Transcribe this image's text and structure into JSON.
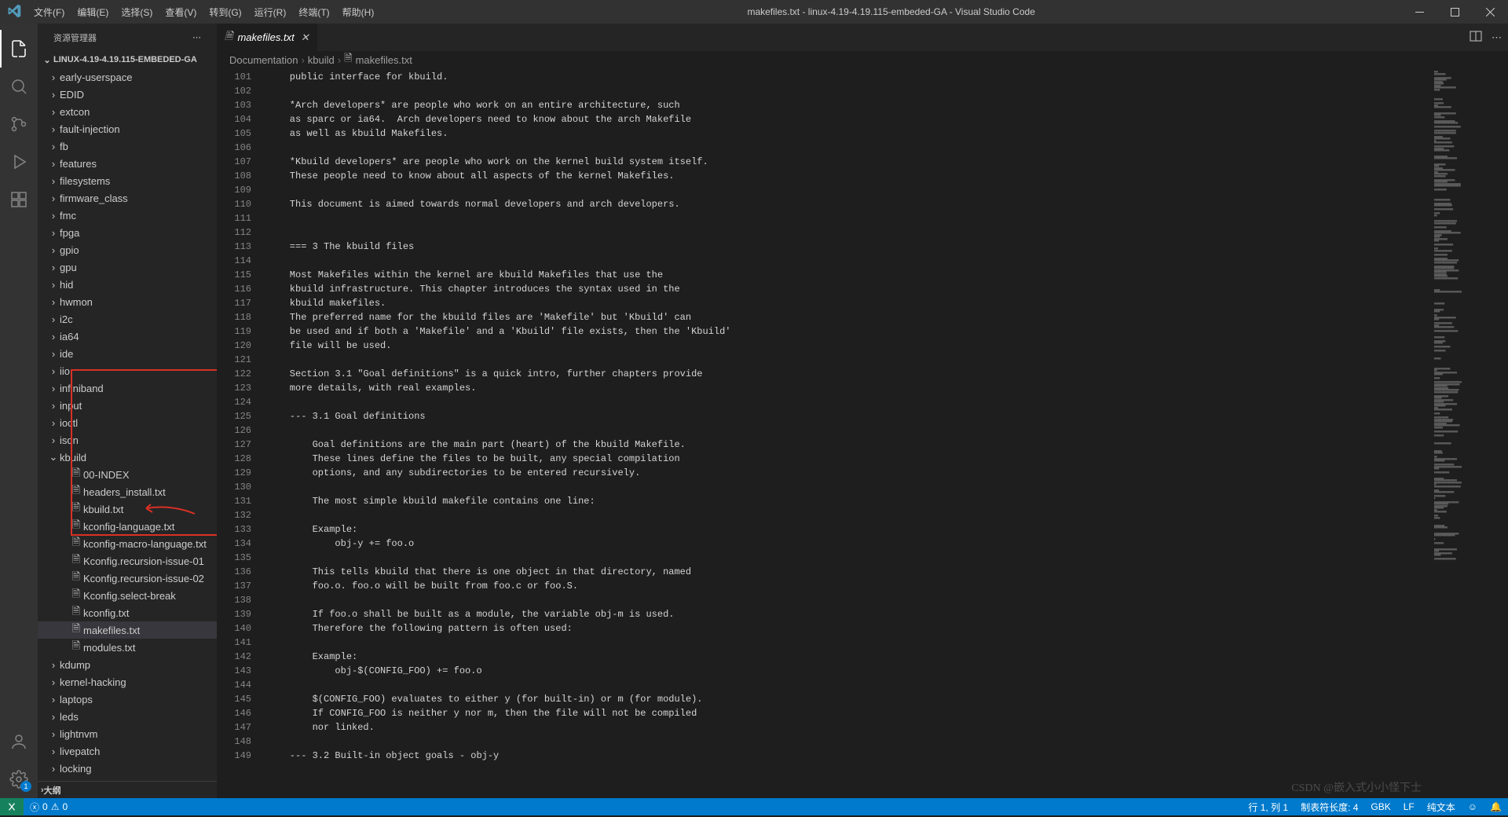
{
  "titlebar": {
    "menus": [
      "文件(F)",
      "编辑(E)",
      "选择(S)",
      "查看(V)",
      "转到(G)",
      "运行(R)",
      "终端(T)",
      "帮助(H)"
    ],
    "title": "makefiles.txt - linux-4.19-4.19.115-embeded-GA - Visual Studio Code"
  },
  "sidebar": {
    "header": "资源管理器",
    "section": "LINUX-4.19-4.19.115-EMBEDED-GA",
    "outline": "大纲",
    "folders": [
      "early-userspace",
      "EDID",
      "extcon",
      "fault-injection",
      "fb",
      "features",
      "filesystems",
      "firmware_class",
      "fmc",
      "fpga",
      "gpio",
      "gpu",
      "hid",
      "hwmon",
      "i2c",
      "ia64",
      "ide",
      "iio",
      "infiniband",
      "input",
      "ioctl",
      "isdn"
    ],
    "kbuild": "kbuild",
    "kbuild_files": [
      "00-INDEX",
      "headers_install.txt",
      "kbuild.txt",
      "kconfig-language.txt",
      "kconfig-macro-language.txt",
      "Kconfig.recursion-issue-01",
      "Kconfig.recursion-issue-02",
      "Kconfig.select-break",
      "kconfig.txt",
      "makefiles.txt",
      "modules.txt"
    ],
    "folders_after": [
      "kdump",
      "kernel-hacking",
      "laptops",
      "leds",
      "lightnvm",
      "livepatch",
      "locking"
    ]
  },
  "tab": {
    "label": "makefiles.txt"
  },
  "breadcrumb": {
    "p0": "Documentation",
    "p1": "kbuild",
    "p2": "makefiles.txt"
  },
  "code": {
    "start": 101,
    "lines": [
      "public interface for kbuild.",
      "",
      "*Arch developers* are people who work on an entire architecture, such",
      "as sparc or ia64.  Arch developers need to know about the arch Makefile",
      "as well as kbuild Makefiles.",
      "",
      "*Kbuild developers* are people who work on the kernel build system itself.",
      "These people need to know about all aspects of the kernel Makefiles.",
      "",
      "This document is aimed towards normal developers and arch developers.",
      "",
      "",
      "=== 3 The kbuild files",
      "",
      "Most Makefiles within the kernel are kbuild Makefiles that use the",
      "kbuild infrastructure. This chapter introduces the syntax used in the",
      "kbuild makefiles.",
      "The preferred name for the kbuild files are 'Makefile' but 'Kbuild' can",
      "be used and if both a 'Makefile' and a 'Kbuild' file exists, then the 'Kbuild'",
      "file will be used.",
      "",
      "Section 3.1 \"Goal definitions\" is a quick intro, further chapters provide",
      "more details, with real examples.",
      "",
      "--- 3.1 Goal definitions",
      "",
      "    Goal definitions are the main part (heart) of the kbuild Makefile.",
      "    These lines define the files to be built, any special compilation",
      "    options, and any subdirectories to be entered recursively.",
      "",
      "    The most simple kbuild makefile contains one line:",
      "",
      "    Example:",
      "        obj-y += foo.o",
      "",
      "    This tells kbuild that there is one object in that directory, named",
      "    foo.o. foo.o will be built from foo.c or foo.S.",
      "",
      "    If foo.o shall be built as a module, the variable obj-m is used.",
      "    Therefore the following pattern is often used:",
      "",
      "    Example:",
      "        obj-$(CONFIG_FOO) += foo.o",
      "",
      "    $(CONFIG_FOO) evaluates to either y (for built-in) or m (for module).",
      "    If CONFIG_FOO is neither y nor m, then the file will not be compiled",
      "    nor linked.",
      "",
      "--- 3.2 Built-in object goals - obj-y"
    ]
  },
  "statusbar": {
    "errors": "0",
    "warnings": "0",
    "cursor": "行 1, 列 1",
    "tabsize": "制表符长度: 4",
    "encoding": "GBK",
    "eol": "LF",
    "lang": "纯文本",
    "feedback": "☺",
    "bell": "🔔"
  },
  "settings_badge": "1",
  "watermark": "CSDN @嵌入式小小怪下士"
}
